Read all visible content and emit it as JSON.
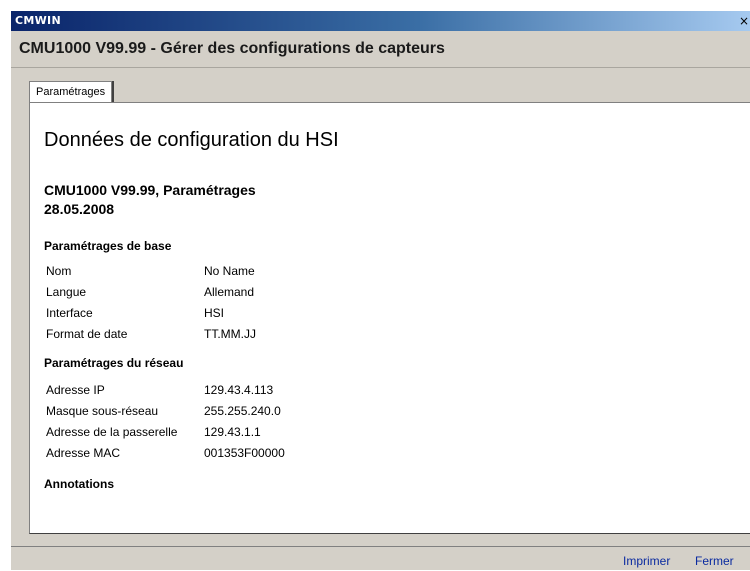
{
  "window": {
    "title": "CMWIN",
    "close_glyph": "×"
  },
  "header": {
    "text": "CMU1000 V99.99 - Gérer des configurations de capteurs"
  },
  "tabs": [
    {
      "label": "Paramétrages",
      "active": true
    }
  ],
  "report": {
    "title": "Données de configuration du HSI",
    "subtitle": "CMU1000 V99.99, Paramétrages",
    "date": "28.05.2008",
    "sections": [
      {
        "title": "Paramétrages de base",
        "rows": [
          {
            "key": "Nom",
            "value": "No Name"
          },
          {
            "key": "Langue",
            "value": "Allemand"
          },
          {
            "key": "Interface",
            "value": "HSI"
          },
          {
            "key": "Format de date",
            "value": "TT.MM.JJ"
          }
        ]
      },
      {
        "title": "Paramétrages du réseau",
        "rows": [
          {
            "key": "Adresse IP",
            "value": "129.43.4.113"
          },
          {
            "key": "Masque sous-réseau",
            "value": "255.255.240.0"
          },
          {
            "key": "Adresse de la passerelle",
            "value": "129.43.1.1"
          },
          {
            "key": "Adresse MAC",
            "value": "001353F00000"
          }
        ]
      },
      {
        "title": "Annotations",
        "rows": []
      }
    ]
  },
  "footer": {
    "print_label": "Imprimer",
    "close_label": "Fermer"
  },
  "colors": {
    "titlebar_start": "#0a246a",
    "titlebar_end": "#a6caf0",
    "face": "#d4d0c8",
    "link": "#0a2aa0"
  }
}
